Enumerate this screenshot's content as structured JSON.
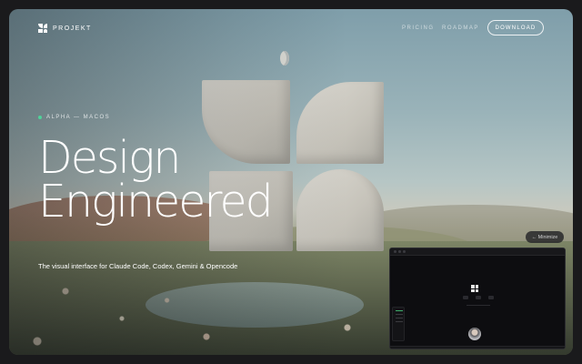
{
  "brand": {
    "name": "PROJEKT"
  },
  "nav": {
    "links": [
      "PRICING",
      "ROADMAP"
    ],
    "download_label": "DOWNLOAD"
  },
  "hero": {
    "badge": "ALPHA — MACOS",
    "headline_line1": "Design",
    "headline_line2": "Engineered",
    "subtitle": "The visual interface for Claude Code, Codex, Gemini & Opencode"
  },
  "preview": {
    "minimize_label": "← Minimize"
  },
  "colors": {
    "accent_green": "#4fd39a",
    "text": "#ffffff"
  },
  "icons": [
    "logo-icon",
    "status-dot-icon",
    "arrow-left-icon"
  ]
}
